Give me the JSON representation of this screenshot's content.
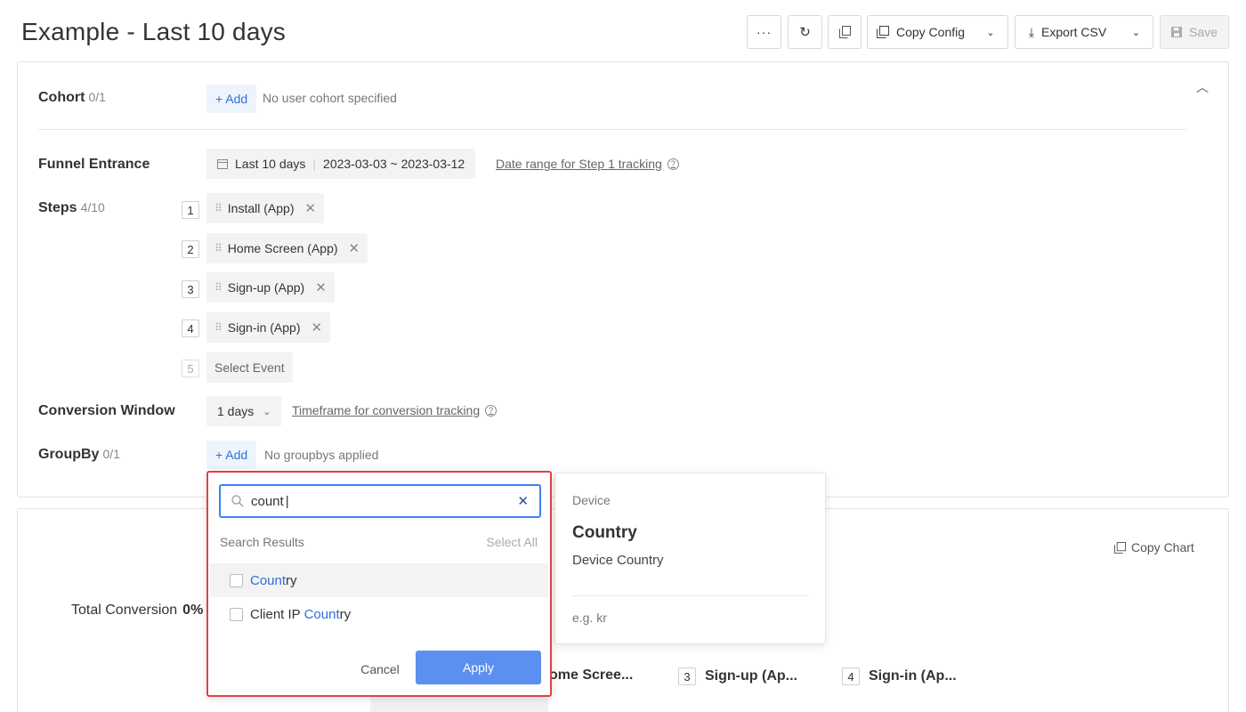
{
  "header": {
    "title": "Example - Last 10 days",
    "more_icon": "more-icon",
    "refresh_icon": "refresh-icon",
    "duplicate_icon": "duplicate-icon",
    "copy_config_label": "Copy Config",
    "export_csv_label": "Export CSV",
    "save_label": "Save"
  },
  "cohort": {
    "label": "Cohort",
    "count": "0/1",
    "add_label": "+ Add",
    "empty_text": "No user cohort specified"
  },
  "funnel_entrance": {
    "label": "Funnel Entrance",
    "range_name": "Last 10 days",
    "range_dates": "2023-03-03 ~ 2023-03-12",
    "help_link": "Date range for Step 1 tracking"
  },
  "steps": {
    "label": "Steps",
    "count": "4/10",
    "items": [
      {
        "num": "1",
        "name": "Install (App)"
      },
      {
        "num": "2",
        "name": "Home Screen (App)"
      },
      {
        "num": "3",
        "name": "Sign-up (App)"
      },
      {
        "num": "4",
        "name": "Sign-in (App)"
      }
    ],
    "next_num": "5",
    "select_event_label": "Select Event"
  },
  "conversion_window": {
    "label": "Conversion Window",
    "value": "1 days",
    "help_link": "Timeframe for conversion tracking"
  },
  "groupby": {
    "label": "GroupBy",
    "count": "0/1",
    "add_label": "+ Add",
    "empty_text": "No groupbys applied"
  },
  "groupby_dropdown": {
    "search_value": "count",
    "results_label": "Search Results",
    "select_all_label": "Select All",
    "options": [
      {
        "prefix": "",
        "match": "Count",
        "suffix": "ry"
      },
      {
        "prefix": "Client IP ",
        "match": "Count",
        "suffix": "ry"
      }
    ],
    "cancel_label": "Cancel",
    "apply_label": "Apply"
  },
  "detail_card": {
    "category": "Device",
    "name": "Country",
    "description": "Device Country",
    "example": "e.g. kr"
  },
  "results": {
    "total_conversion_label": "Total Conversion",
    "total_conversion_value": "0%",
    "copy_chart_label": "Copy Chart",
    "legend": [
      {
        "num": "",
        "label": "ome Scree..."
      },
      {
        "num": "3",
        "label": "Sign-up (Ap..."
      },
      {
        "num": "4",
        "label": "Sign-in (Ap..."
      }
    ]
  },
  "colors": {
    "accent": "#2f6fd8",
    "apply_button": "#5b8ff0",
    "dropdown_border": "#e53e3e"
  }
}
